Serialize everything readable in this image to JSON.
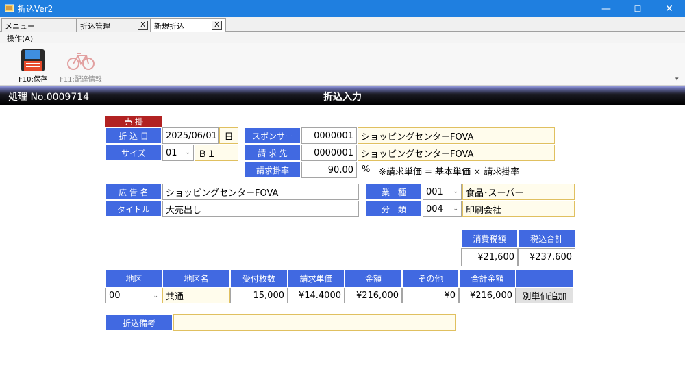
{
  "window": {
    "title": "折込Ver2",
    "min_glyph": "—",
    "max_glyph": "☐",
    "close_glyph": "✕"
  },
  "tabs": [
    {
      "label": "メニュー",
      "closable": false,
      "active": false
    },
    {
      "label": "折込管理",
      "closable": true,
      "active": false
    },
    {
      "label": "新規折込",
      "closable": true,
      "active": true
    }
  ],
  "tab_close_glyph": "X",
  "menu": {
    "operation": "操作(A)"
  },
  "toolbar": {
    "save_label": "F10:保存",
    "delivery_label": "F11:配達情報",
    "overflow_glyph": "▾"
  },
  "header": {
    "process_no": "処理 No.0009714",
    "title": "折込入力"
  },
  "form": {
    "status_badge": "売 掛",
    "insert_date_label": "折 込 日",
    "insert_date_value": "2025/06/01",
    "weekday": "日",
    "size_label": "サイズ",
    "size_code": "01",
    "size_name": "Ｂ１",
    "sponsor_label": "スポンサー",
    "sponsor_code": "0000001",
    "sponsor_name": "ショッピングセンターFOVA",
    "billing_label": "請 求 先",
    "billing_code": "0000001",
    "billing_name": "ショッピングセンターFOVA",
    "rate_label": "請求掛率",
    "rate_value": "90.00",
    "rate_unit": "%",
    "rate_note": "※請求単価 = 基本単価 × 請求掛率",
    "ad_name_label": "広 告 名",
    "ad_name_value": "ショッピングセンターFOVA",
    "title_label": "タイトル",
    "title_value": "大売出し",
    "industry_label": "業　種",
    "industry_code": "001",
    "industry_name": "食品･スーパー",
    "category_label": "分　類",
    "category_code": "004",
    "category_name": "印刷会社",
    "remarks_label": "折込備考",
    "remarks_value": ""
  },
  "tax": {
    "headers": [
      "消費税額",
      "税込合計"
    ],
    "values": [
      "¥21,600",
      "¥237,600"
    ]
  },
  "grid": {
    "headers": [
      "地区",
      "地区名",
      "受付枚数",
      "請求単価",
      "金額",
      "その他",
      "合計金額",
      ""
    ],
    "row": {
      "area_code": "00",
      "area_name": "共通",
      "count": "15,000",
      "unit_price": "¥14.4000",
      "amount": "¥216,000",
      "other": "¥0",
      "total": "¥216,000"
    },
    "add_button": "別単価追加"
  },
  "colors": {
    "label_bg": "#4169e1",
    "badge_bg": "#b22222",
    "titlebar_bg": "#1f7fe0",
    "readonly_bg": "#fffcec"
  }
}
